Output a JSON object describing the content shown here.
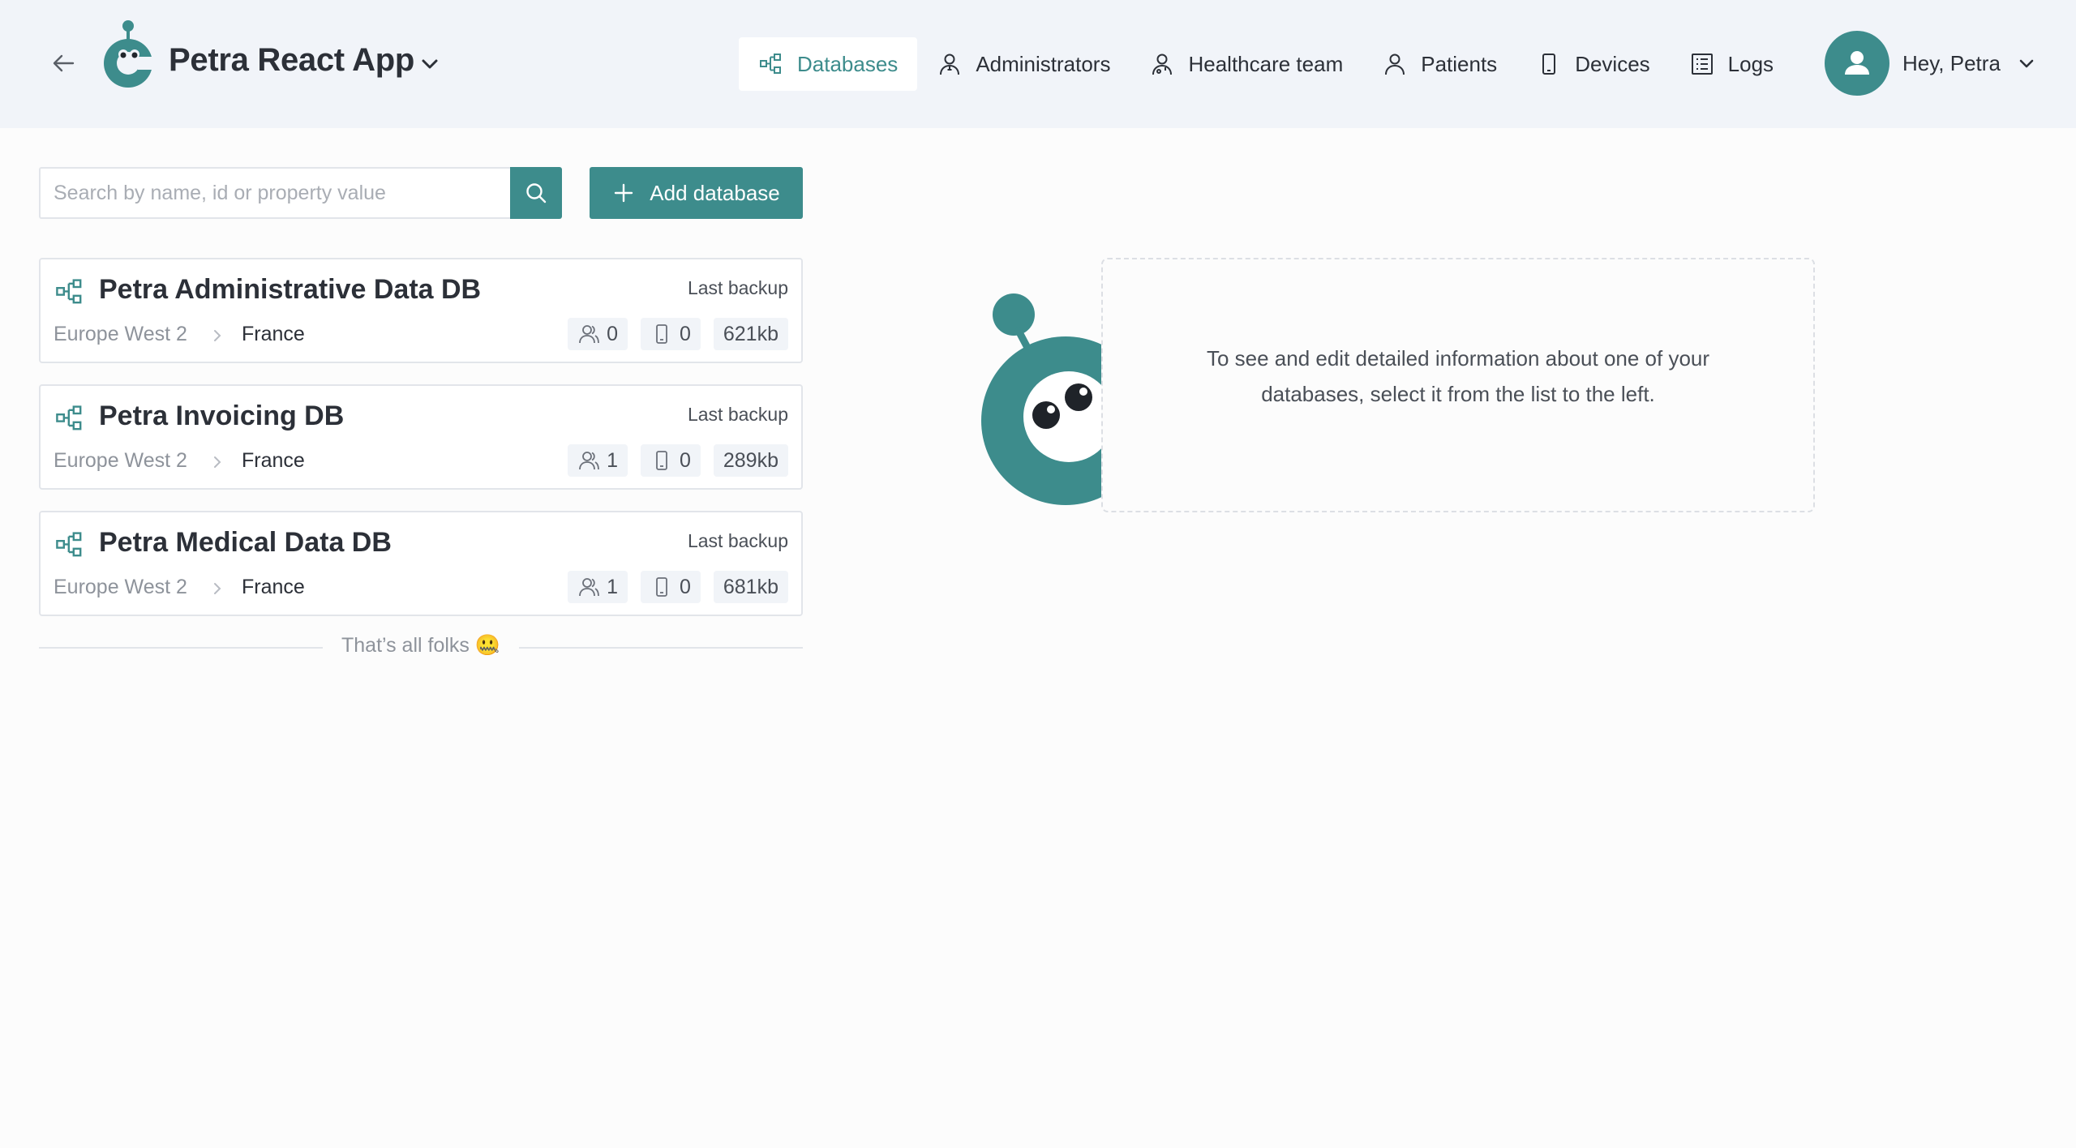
{
  "header": {
    "app_title": "Petra React App",
    "nav": [
      {
        "label": "Databases",
        "icon": "databases-icon",
        "active": true
      },
      {
        "label": "Administrators",
        "icon": "administrator-icon",
        "active": false
      },
      {
        "label": "Healthcare team",
        "icon": "healthcare-team-icon",
        "active": false
      },
      {
        "label": "Patients",
        "icon": "patient-icon",
        "active": false
      },
      {
        "label": "Devices",
        "icon": "device-icon",
        "active": false
      },
      {
        "label": "Logs",
        "icon": "logs-icon",
        "active": false
      }
    ],
    "user_greeting": "Hey, Petra"
  },
  "search": {
    "placeholder": "Search by name, id or property value",
    "value": ""
  },
  "add_button_label": "Add database",
  "databases": [
    {
      "name": "Petra Administrative Data DB",
      "backup_label": "Last backup",
      "region": "Europe West 2",
      "country": "France",
      "users": "0",
      "devices": "0",
      "size": "621kb"
    },
    {
      "name": "Petra Invoicing DB",
      "backup_label": "Last backup",
      "region": "Europe West 2",
      "country": "France",
      "users": "1",
      "devices": "0",
      "size": "289kb"
    },
    {
      "name": "Petra Medical Data DB",
      "backup_label": "Last backup",
      "region": "Europe West 2",
      "country": "France",
      "users": "1",
      "devices": "0",
      "size": "681kb"
    }
  ],
  "list_end_text": "That’s all folks 🤐",
  "empty_state": {
    "text": "To see and edit detailed information about one of your databases, select it from the list to the left."
  },
  "colors": {
    "accent": "#3d8c8c",
    "header_bg": "#f1f4f9",
    "text": "#2c3038",
    "muted": "#8e939b"
  }
}
